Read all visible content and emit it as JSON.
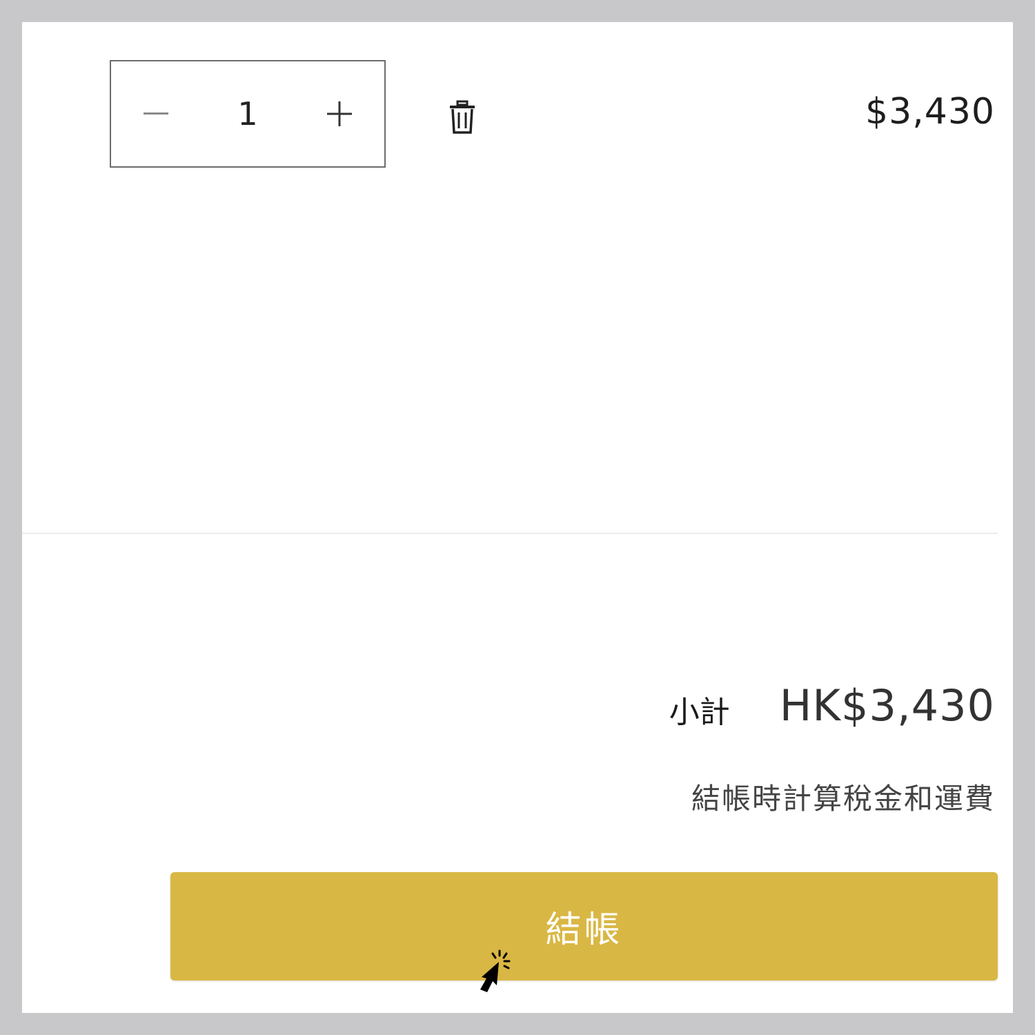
{
  "cart_item": {
    "quantity": "1",
    "line_price": "$3,430"
  },
  "summary": {
    "subtotal_label": "小計",
    "subtotal_value": "HK$3,430",
    "tax_note": "結帳時計算稅金和運費"
  },
  "checkout": {
    "label": "結帳"
  },
  "icons": {
    "decrease": "minus-icon",
    "increase": "plus-icon",
    "remove": "trash-icon",
    "pointer": "hand-pointer-cursor-icon"
  },
  "colors": {
    "checkout_button": "#d9b744",
    "page_frame": "#c8c8ca"
  }
}
